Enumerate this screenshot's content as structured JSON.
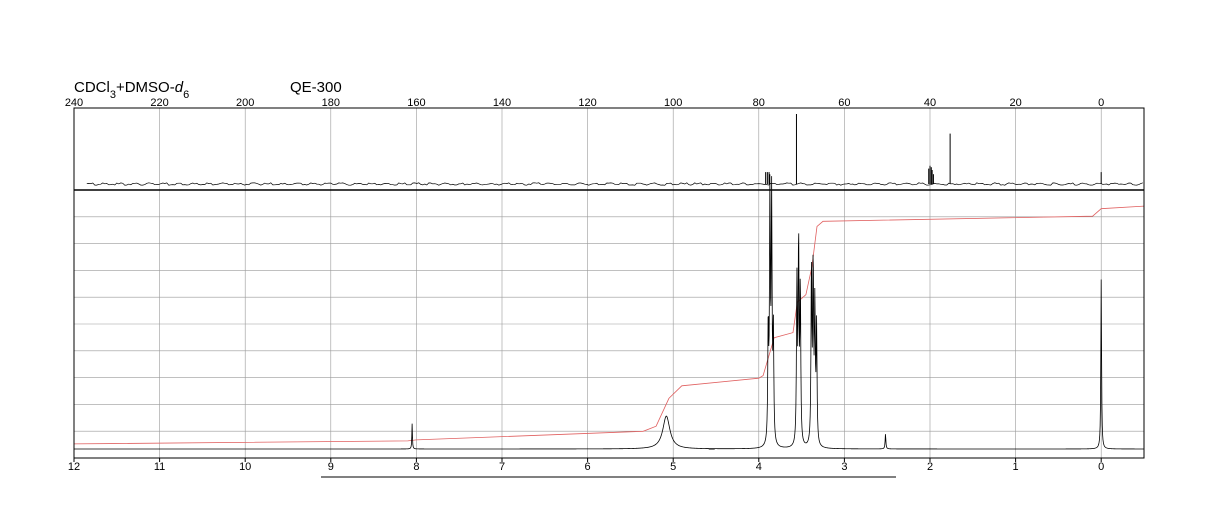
{
  "header": {
    "solvent_main": "CDCl",
    "solvent_sub1": "3",
    "solvent_mid": "+DMSO-",
    "solvent_d": "d",
    "solvent_sub2": "6",
    "instrument": "QE-300"
  },
  "colors": {
    "trace": "#000000",
    "integral": "#e06060",
    "grid": "#9a9a9a",
    "axis": "#000000"
  },
  "chart_data": [
    {
      "type": "line",
      "title": "",
      "nucleus": "13C",
      "x_unit": "ppm",
      "xlim": [
        240,
        -10
      ],
      "tick_labels": [
        "240",
        "220",
        "200",
        "180",
        "160",
        "140",
        "120",
        "100",
        "80",
        "60",
        "40",
        "20",
        "0"
      ],
      "tick_values": [
        240,
        220,
        200,
        180,
        160,
        140,
        120,
        100,
        80,
        60,
        40,
        20,
        0
      ],
      "baseline_start_ppm": 237,
      "peaks": [
        {
          "ppm": 78.4,
          "height": 0.17
        },
        {
          "ppm": 78.0,
          "height": 0.17
        },
        {
          "ppm": 77.6,
          "height": 0.17
        },
        {
          "ppm": 71.2,
          "height": 1.0
        },
        {
          "ppm": 40.3,
          "height": 0.22
        },
        {
          "ppm": 40.0,
          "height": 0.26
        },
        {
          "ppm": 39.7,
          "height": 0.24
        },
        {
          "ppm": 39.5,
          "height": 0.2
        },
        {
          "ppm": 39.2,
          "height": 0.14
        },
        {
          "ppm": 35.3,
          "height": 0.72
        },
        {
          "ppm": 0.0,
          "height": 0.17
        }
      ]
    },
    {
      "type": "line",
      "title": "",
      "nucleus": "1H",
      "x_unit": "ppm",
      "xlim": [
        12,
        -0.5
      ],
      "tick_labels": [
        "12",
        "11",
        "10",
        "9",
        "8",
        "7",
        "6",
        "5",
        "4",
        "3",
        "2",
        "1",
        "0"
      ],
      "tick_values": [
        12,
        11,
        10,
        9,
        8,
        7,
        6,
        5,
        4,
        3,
        2,
        1,
        0
      ],
      "grid": true,
      "horizontal_grid_lines": 9,
      "peaks": [
        {
          "ppm": 8.05,
          "height": 0.1,
          "width": 0.004
        },
        {
          "ppm": 5.08,
          "height": 0.13,
          "width": 0.05
        },
        {
          "ppm": 3.89,
          "height": 0.46,
          "width": 0.006
        },
        {
          "ppm": 3.87,
          "height": 0.98,
          "width": 0.006
        },
        {
          "ppm": 3.85,
          "height": 0.95,
          "width": 0.006
        },
        {
          "ppm": 3.83,
          "height": 0.44,
          "width": 0.006
        },
        {
          "ppm": 3.555,
          "height": 0.64,
          "width": 0.006
        },
        {
          "ppm": 3.535,
          "height": 0.8,
          "width": 0.006
        },
        {
          "ppm": 3.515,
          "height": 0.62,
          "width": 0.006
        },
        {
          "ppm": 3.385,
          "height": 0.7,
          "width": 0.006
        },
        {
          "ppm": 3.365,
          "height": 0.7,
          "width": 0.006
        },
        {
          "ppm": 3.345,
          "height": 0.53,
          "width": 0.006
        },
        {
          "ppm": 3.325,
          "height": 0.46,
          "width": 0.006
        },
        {
          "ppm": 2.52,
          "height": 0.06,
          "width": 0.005
        },
        {
          "ppm": 0.0,
          "height": 0.67,
          "width": 0.005
        }
      ],
      "integral_curve": [
        {
          "ppm": 12.0,
          "level": 0.02
        },
        {
          "ppm": 8.1,
          "level": 0.032
        },
        {
          "ppm": 8.0,
          "level": 0.036
        },
        {
          "ppm": 5.35,
          "level": 0.07
        },
        {
          "ppm": 5.2,
          "level": 0.09
        },
        {
          "ppm": 5.05,
          "level": 0.2
        },
        {
          "ppm": 4.9,
          "level": 0.25
        },
        {
          "ppm": 4.0,
          "level": 0.28
        },
        {
          "ppm": 3.95,
          "level": 0.29
        },
        {
          "ppm": 3.82,
          "level": 0.44
        },
        {
          "ppm": 3.6,
          "level": 0.46
        },
        {
          "ppm": 3.55,
          "level": 0.58
        },
        {
          "ppm": 3.45,
          "level": 0.61
        },
        {
          "ppm": 3.38,
          "level": 0.72
        },
        {
          "ppm": 3.32,
          "level": 0.88
        },
        {
          "ppm": 3.25,
          "level": 0.9
        },
        {
          "ppm": 0.1,
          "level": 0.92
        },
        {
          "ppm": 0.0,
          "level": 0.95
        },
        {
          "ppm": -0.5,
          "level": 0.96
        }
      ]
    }
  ]
}
